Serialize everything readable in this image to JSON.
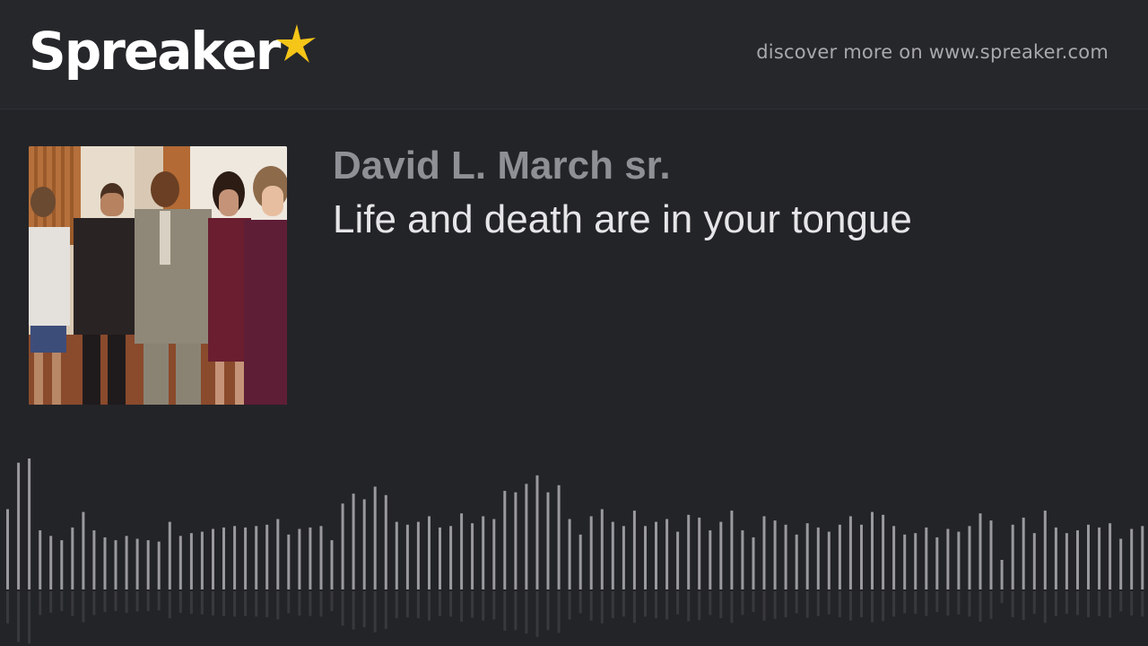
{
  "header": {
    "logo_text": "Spreaker",
    "discover_text": "discover more on www.spreaker.com"
  },
  "episode": {
    "author": "David L. March sr.",
    "title": "Life and death are in your tongue"
  },
  "colors": {
    "background": "#232428",
    "header_background": "#26272b",
    "logo_star": "#f5c518",
    "waveform_bar": "#9a9a9e"
  },
  "icons": {
    "logo_star": "star-icon"
  },
  "waveform": {
    "levels": [
      0.57,
      0.9,
      0.93,
      0.42,
      0.38,
      0.35,
      0.44,
      0.55,
      0.42,
      0.37,
      0.35,
      0.38,
      0.36,
      0.35,
      0.34,
      0.48,
      0.38,
      0.4,
      0.41,
      0.43,
      0.44,
      0.45,
      0.44,
      0.45,
      0.46,
      0.5,
      0.39,
      0.43,
      0.44,
      0.45,
      0.35,
      0.61,
      0.68,
      0.64,
      0.73,
      0.67,
      0.48,
      0.46,
      0.48,
      0.52,
      0.44,
      0.45,
      0.54,
      0.47,
      0.52,
      0.5,
      0.7,
      0.69,
      0.75,
      0.81,
      0.69,
      0.74,
      0.5,
      0.39,
      0.52,
      0.57,
      0.48,
      0.45,
      0.56,
      0.45,
      0.48,
      0.5,
      0.41,
      0.53,
      0.51,
      0.42,
      0.48,
      0.56,
      0.42,
      0.37,
      0.52,
      0.49,
      0.46,
      0.39,
      0.47,
      0.44,
      0.41,
      0.46,
      0.52,
      0.46,
      0.55,
      0.53,
      0.45,
      0.39,
      0.4,
      0.44,
      0.37,
      0.43,
      0.41,
      0.45,
      0.54,
      0.49,
      0.21,
      0.46,
      0.51,
      0.4,
      0.56,
      0.44,
      0.4,
      0.42,
      0.46,
      0.44,
      0.47,
      0.36,
      0.43,
      0.45,
      0.4,
      0.37,
      0.32,
      0.44
    ]
  }
}
